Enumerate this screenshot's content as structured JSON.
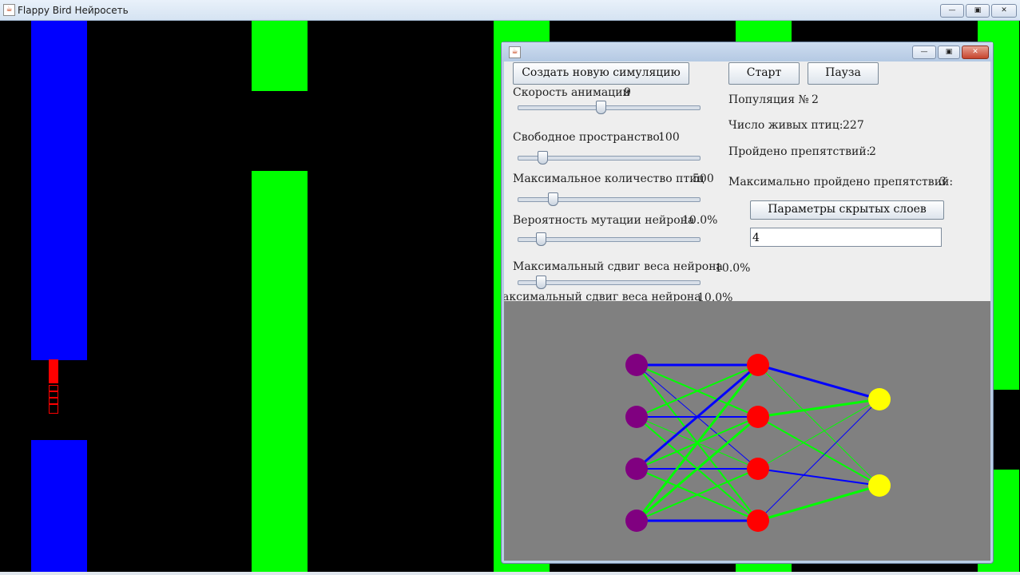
{
  "window": {
    "title": "Flappy Bird Нейросеть"
  },
  "controls": {
    "new_simulation": "Создать новую симуляцию",
    "start": "Старт",
    "pause": "Пауза",
    "hidden_layers_button": "Параметры скрытых слоев",
    "hidden_layers_value": "4"
  },
  "sliders": {
    "anim_speed": {
      "label": "Скорость анимации",
      "value": "9",
      "level": 0.45
    },
    "free_space": {
      "label": "Свободное пространство",
      "value": "100",
      "level": 0.11
    },
    "max_birds": {
      "label": "Максимальное количество птиц",
      "value": "500",
      "level": 0.17
    },
    "mutation_prob": {
      "label": "Вероятность мутации нейрона",
      "value": "10.0%",
      "level": 0.1
    },
    "max_shift": {
      "label": "Максимальный сдвиг веса нейрона",
      "value": "10.0%",
      "level": 0.1
    },
    "max_shift_ghost": {
      "label": "аксимальный сдвиг веса нейрона",
      "value": "10.0%"
    }
  },
  "stats": {
    "population_label": "Популяция №",
    "population_value": "2",
    "alive_label": "Число живых птиц:",
    "alive_value": "227",
    "passed_label": "Пройдено препятствий:",
    "passed_value": "2",
    "max_passed_label": "Максимально пройдено препятствий:",
    "max_passed_value": "3"
  },
  "network": {
    "layers": [
      4,
      4,
      2
    ],
    "colors": {
      "input": "#800080",
      "hidden": "#ff0000",
      "output": "#ffff00",
      "positive": "#00ff00",
      "negative": "#0000ff",
      "background": "#808080"
    }
  }
}
